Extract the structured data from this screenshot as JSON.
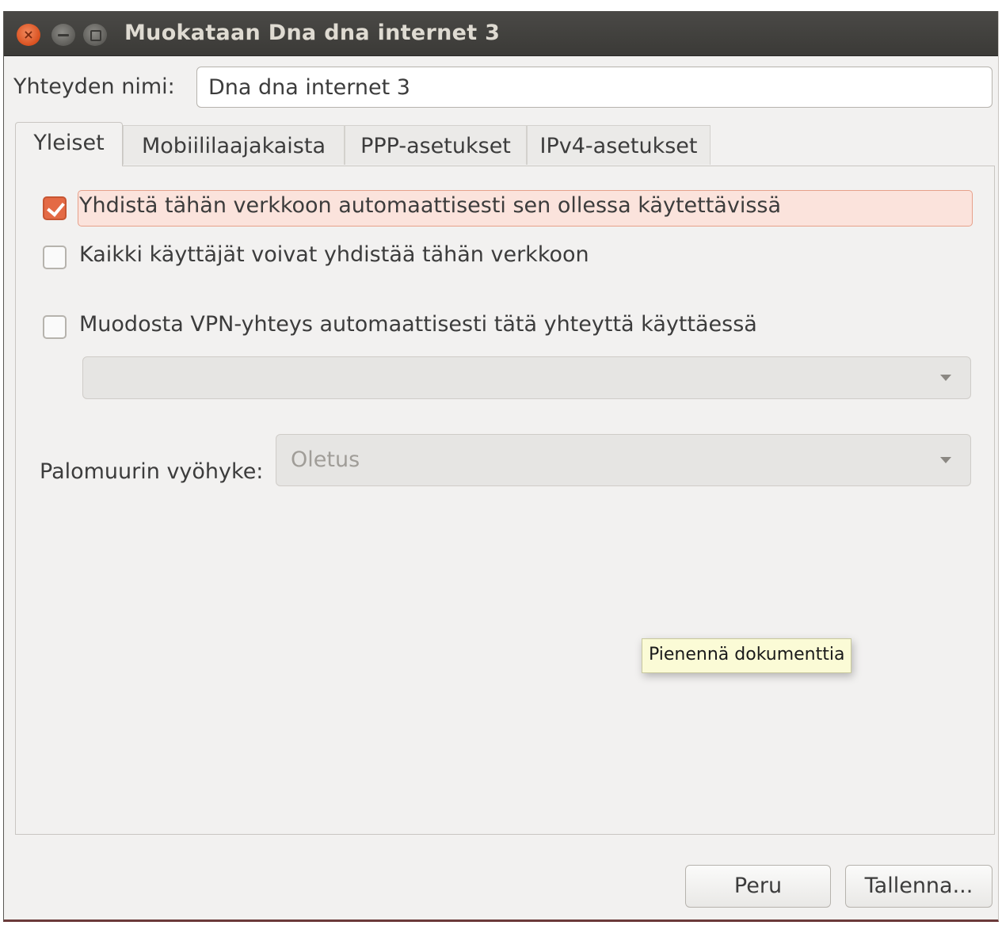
{
  "window": {
    "title": "Muokataan Dna dna internet 3"
  },
  "connection_name": {
    "label": "Yhteyden nimi:",
    "value": "Dna dna internet 3"
  },
  "tabs": [
    {
      "label": "Yleiset",
      "active": true
    },
    {
      "label": "Mobiililaajakaista",
      "active": false
    },
    {
      "label": "PPP-asetukset",
      "active": false
    },
    {
      "label": "IPv4-asetukset",
      "active": false
    }
  ],
  "general": {
    "auto_connect": {
      "label": "Yhdistä tähän verkkoon automaattisesti sen ollessa käytettävissä",
      "checked": true
    },
    "all_users": {
      "label": "Kaikki käyttäjät voivat yhdistää tähän verkkoon",
      "checked": false
    },
    "auto_vpn": {
      "label": "Muodosta VPN-yhteys automaattisesti tätä yhteyttä käyttäessä",
      "checked": false
    },
    "vpn_select_value": "",
    "firewall_zone": {
      "label": "Palomuurin vyöhyke:",
      "value": "Oletus"
    }
  },
  "tooltip": "Pienennä dokumenttia",
  "buttons": {
    "cancel": "Peru",
    "save": "Tallenna..."
  },
  "colors": {
    "accent": "#e46a45",
    "titlebar": "#3c3b37"
  }
}
